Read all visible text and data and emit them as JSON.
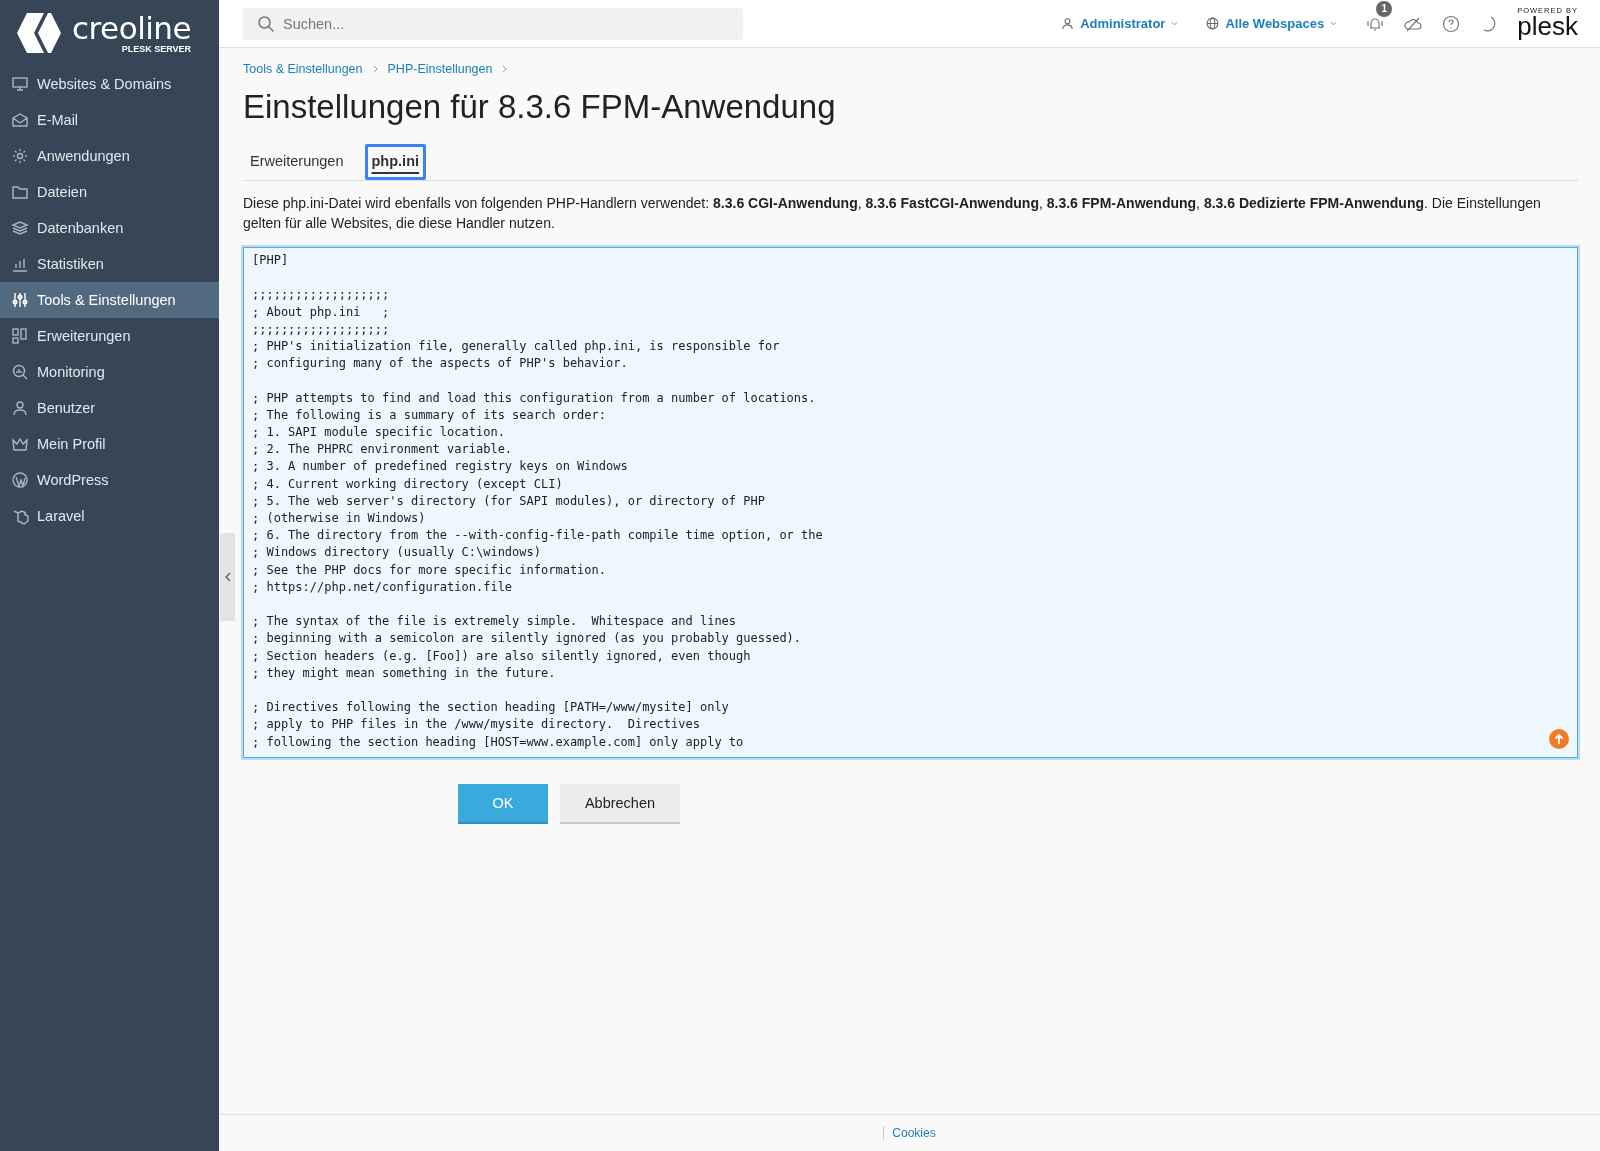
{
  "sidebar": {
    "logo": {
      "name": "creoline",
      "subtitle": "PLESK SERVER"
    },
    "items": [
      {
        "label": "Websites & Domains",
        "selected": false
      },
      {
        "label": "E-Mail",
        "selected": false
      },
      {
        "label": "Anwendungen",
        "selected": false
      },
      {
        "label": "Dateien",
        "selected": false
      },
      {
        "label": "Datenbanken",
        "selected": false
      },
      {
        "label": "Statistiken",
        "selected": false
      },
      {
        "label": "Tools & Einstellungen",
        "selected": true
      },
      {
        "label": "Erweiterungen",
        "selected": false
      },
      {
        "label": "Monitoring",
        "selected": false
      },
      {
        "label": "Benutzer",
        "selected": false
      },
      {
        "label": "Mein Profil",
        "selected": false
      },
      {
        "label": "WordPress",
        "selected": false
      },
      {
        "label": "Laravel",
        "selected": false
      }
    ]
  },
  "topbar": {
    "search": {
      "placeholder": "Suchen..."
    },
    "user": "Administrator",
    "webspaces": "Alle Webspaces",
    "notification_count": "1",
    "powered_by": "POWERED BY",
    "brand": "plesk"
  },
  "breadcrumbs": [
    "Tools & Einstellungen",
    "PHP-Einstellungen"
  ],
  "title": "Einstellungen für 8.3.6 FPM-Anwendung",
  "tabs": [
    {
      "label": "Erweiterungen",
      "selected": false
    },
    {
      "label": "php.ini",
      "selected": true
    }
  ],
  "description": "Diese php.ini-Datei wird ebenfalls von folgenden PHP-Handlern verwendet: **8.3.6 CGI-Anwendung**, **8.3.6 FastCGI-Anwendung**, **8.3.6 FPM-Anwendung**, **8.3.6 Dedizierte FPM-Anwendung**. Die Einstellungen gelten für alle Websites, die diese Handler nutzen.",
  "editor": {
    "value": "[PHP]\n\n;;;;;;;;;;;;;;;;;;;\n; About php.ini   ;\n;;;;;;;;;;;;;;;;;;;\n; PHP's initialization file, generally called php.ini, is responsible for\n; configuring many of the aspects of PHP's behavior.\n\n; PHP attempts to find and load this configuration from a number of locations.\n; The following is a summary of its search order:\n; 1. SAPI module specific location.\n; 2. The PHPRC environment variable.\n; 3. A number of predefined registry keys on Windows\n; 4. Current working directory (except CLI)\n; 5. The web server's directory (for SAPI modules), or directory of PHP\n; (otherwise in Windows)\n; 6. The directory from the --with-config-file-path compile time option, or the\n; Windows directory (usually C:\\windows)\n; See the PHP docs for more specific information.\n; https://php.net/configuration.file\n\n; The syntax of the file is extremely simple.  Whitespace and lines\n; beginning with a semicolon are silently ignored (as you probably guessed).\n; Section headers (e.g. [Foo]) are also silently ignored, even though\n; they might mean something in the future.\n\n; Directives following the section heading [PATH=/www/mysite] only\n; apply to PHP files in the /www/mysite directory.  Directives\n; following the section heading [HOST=www.example.com] only apply to"
  },
  "buttons": [
    {
      "label": "OK",
      "kind": "primary"
    },
    {
      "label": "Abbrechen",
      "kind": "secondary"
    }
  ],
  "footer": {
    "link": "Cookies"
  }
}
